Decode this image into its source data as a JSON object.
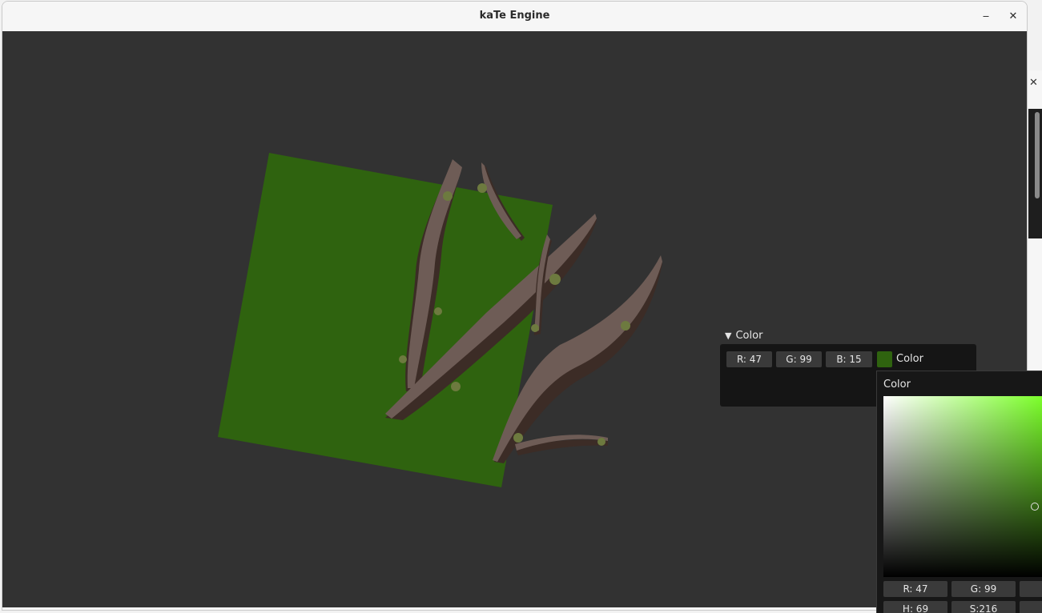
{
  "window": {
    "title": "kaTe Engine",
    "minimize_label": "‒",
    "close_label": "✕"
  },
  "scene": {
    "plane_color": "#2f630f",
    "branch_color": "#6e5c56",
    "branch_shadow": "#3c2c26",
    "moss_color": "#6d7a3f"
  },
  "side_window": {
    "close_label": "✕"
  },
  "color_widget": {
    "header": "Color",
    "r_label": "R: 47",
    "g_label": "G: 99",
    "b_label": "B: 15",
    "swatch_color": "#2f630f",
    "swatch_label": "Color"
  },
  "picker": {
    "title": "Color",
    "hue_color": "#74ff1e",
    "r_label": "R: 47",
    "g_label": "G: 99",
    "h_label": "H: 69",
    "s_label": "S:216"
  }
}
